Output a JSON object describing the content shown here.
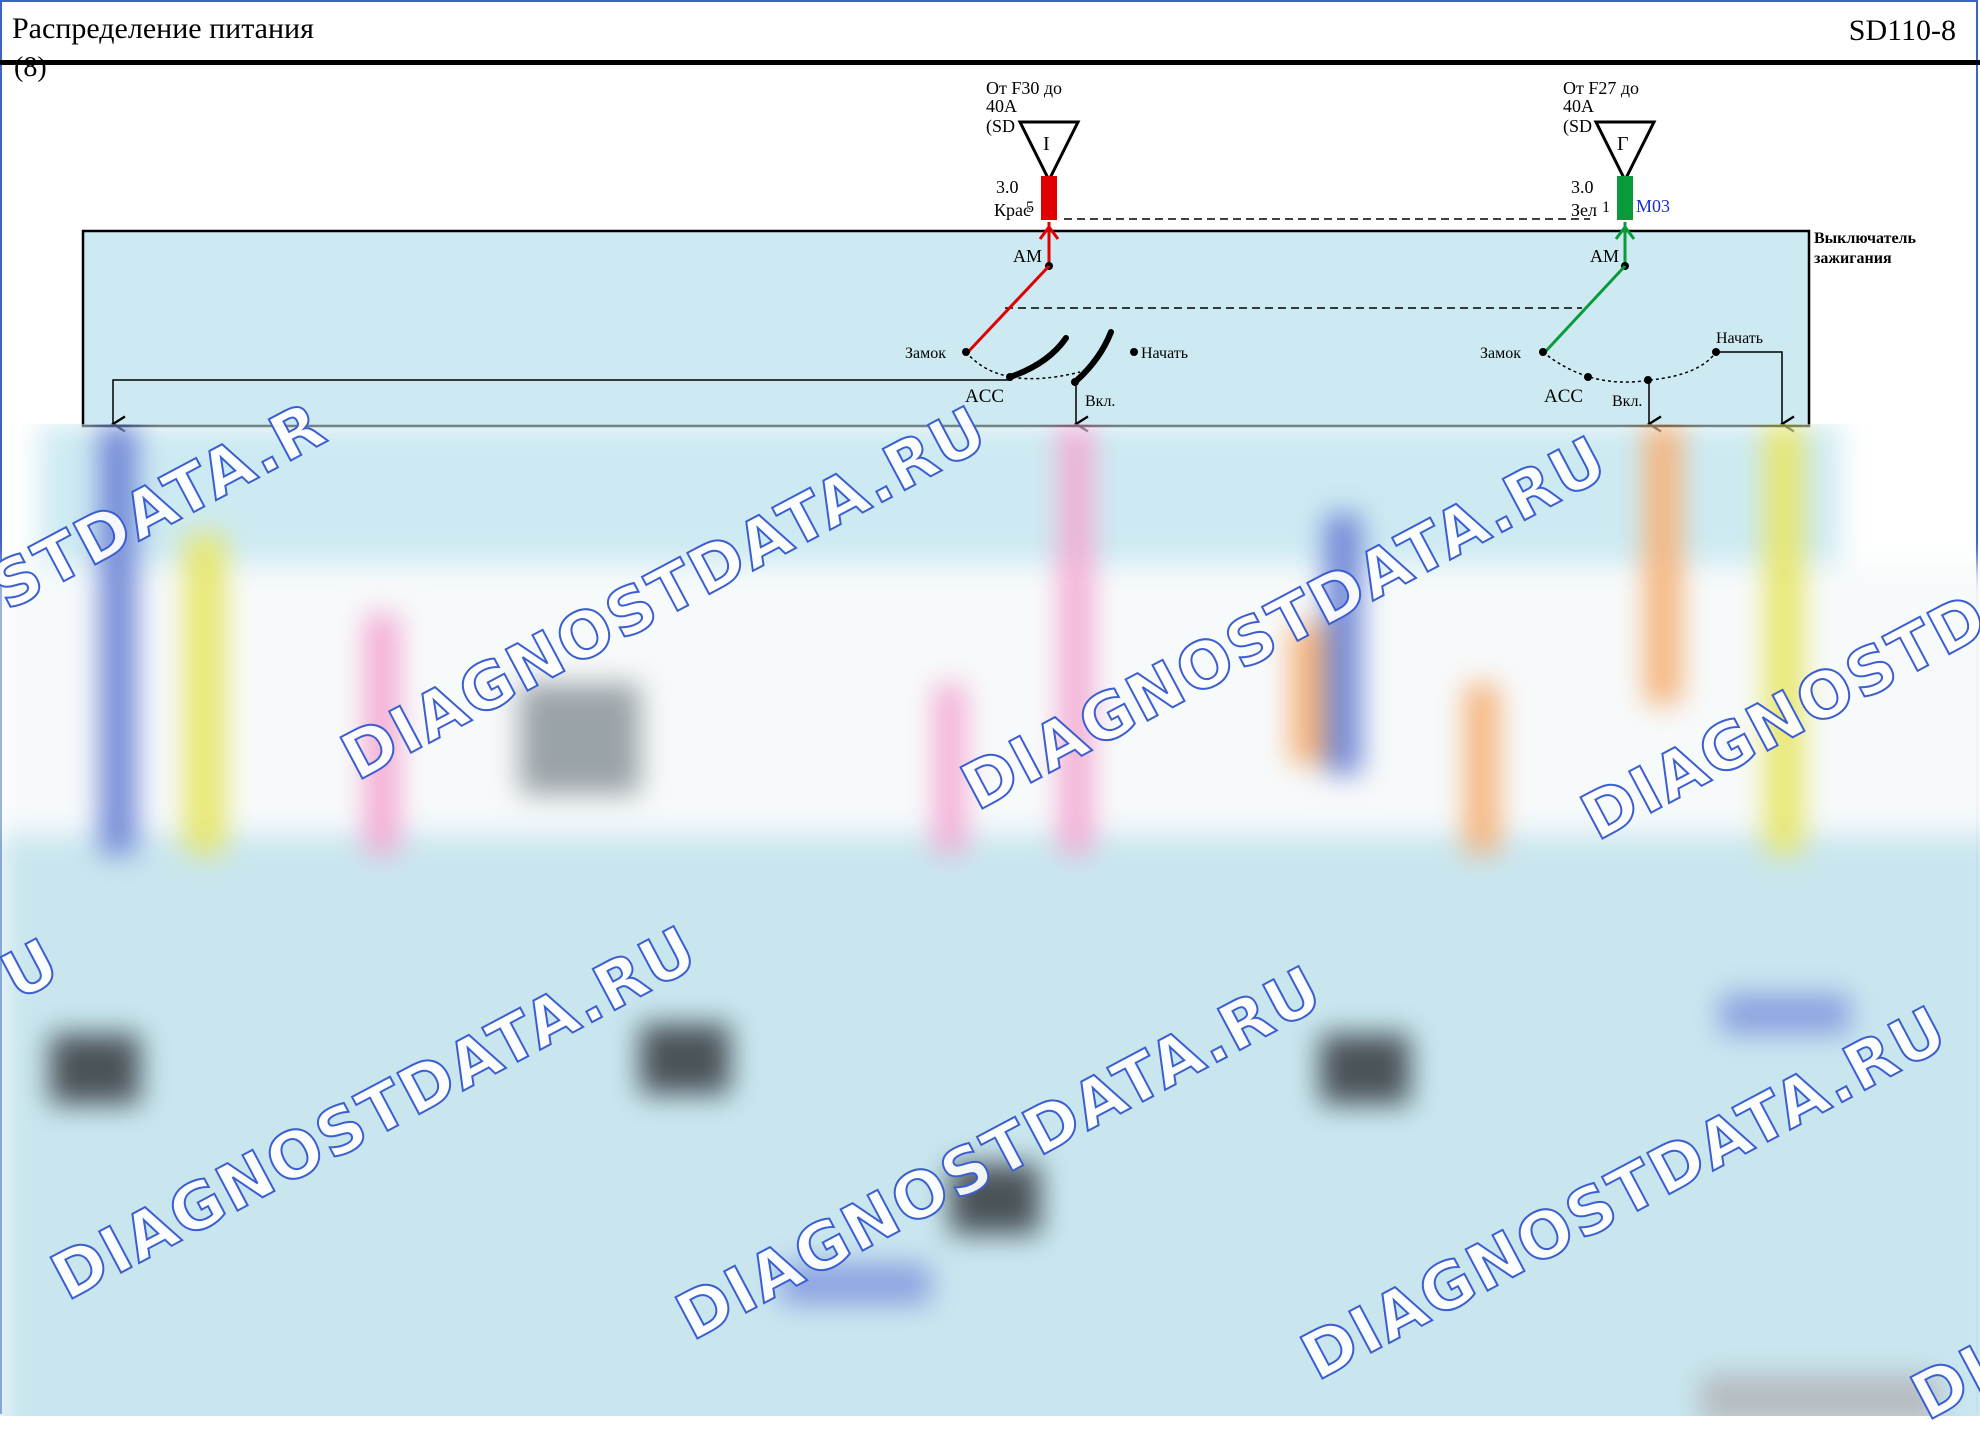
{
  "header": {
    "title": "Распределение питания",
    "subtitle": "(8)",
    "page_code": "SD110-8"
  },
  "diagram": {
    "component_label_line1": "Выключатель",
    "component_label_line2": "зажигания",
    "left": {
      "source_line1": "От F30 до",
      "source_line2": "40A",
      "source_line3": "(SD",
      "connector_letter": "I",
      "wire_size": "3.0",
      "wire_color": "Крас",
      "pin": "5",
      "terminal_am": "AM",
      "pos_lock": "Замок",
      "pos_acc": "ACC",
      "pos_on": "Вкл.",
      "pos_start": "Начать",
      "wire_hex": "#e00000"
    },
    "right": {
      "source_line1": "От F27 до",
      "source_line2": "40A",
      "source_line3": "(SD",
      "connector_letter": "Г",
      "wire_size": "3.0",
      "wire_color": "Зел",
      "pin": "1",
      "connector_code": "M03",
      "terminal_am": "AM",
      "pos_lock": "Замок",
      "pos_acc": "ACC",
      "pos_on": "Вкл.",
      "pos_start": "Начать",
      "wire_hex": "#0a9a3a"
    },
    "switch_fill": "#cdeaf2"
  },
  "watermark": {
    "text": "DIAGNOSTDATA.RU",
    "text_partial_a": "DIAGNOSTDATA.R",
    "text_partial_b": "DIAGNOSTDA",
    "text_partial_c": "STDATA.R",
    "text_partial_d": "U",
    "text_partial_e": "DIA",
    "color": "#3b5fd0"
  }
}
